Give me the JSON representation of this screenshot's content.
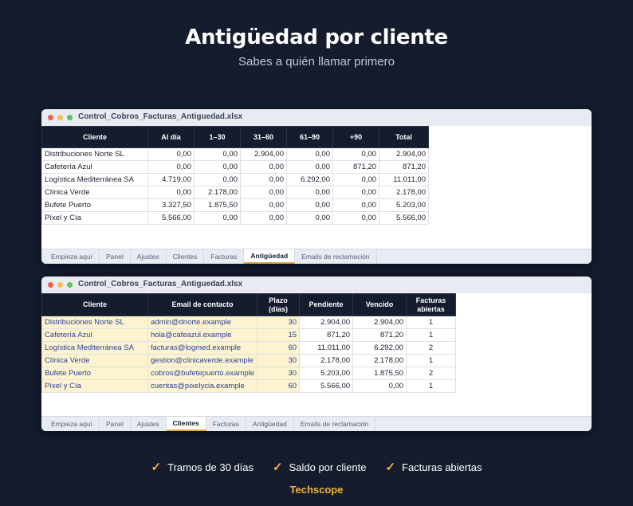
{
  "hero": {
    "title": "Antigüedad por cliente",
    "subtitle": "Sabes a quién llamar primero"
  },
  "colors": {
    "background": "#141c2e",
    "accent": "#f0b43c",
    "header_bg": "#141c2e",
    "highlight": "#fdf4cf",
    "link_text": "#2a3f9a"
  },
  "window1": {
    "filename": "Control_Cobros_Facturas_Antiguedad.xlsx",
    "headers": [
      "Cliente",
      "Al día",
      "1–30",
      "31–60",
      "61–90",
      "+90",
      "Total"
    ],
    "rows": [
      [
        "Distribuciones Norte SL",
        "0,00",
        "0,00",
        "2.904,00",
        "0,00",
        "0,00",
        "2.904,00"
      ],
      [
        "Cafetería Azul",
        "0,00",
        "0,00",
        "0,00",
        "0,00",
        "871,20",
        "871,20"
      ],
      [
        "Logística Mediterránea SA",
        "4.719,00",
        "0,00",
        "0,00",
        "6.292,00",
        "0,00",
        "11.011,00"
      ],
      [
        "Clínica Verde",
        "0,00",
        "2.178,00",
        "0,00",
        "0,00",
        "0,00",
        "2.178,00"
      ],
      [
        "Bufete Puerto",
        "3.327,50",
        "1.875,50",
        "0,00",
        "0,00",
        "0,00",
        "5.203,00"
      ],
      [
        "Píxel y Cía",
        "5.566,00",
        "0,00",
        "0,00",
        "0,00",
        "0,00",
        "5.566,00"
      ]
    ],
    "tabs": [
      "Empieza aquí",
      "Panel",
      "Ajustes",
      "Clientes",
      "Facturas",
      "Antigüedad",
      "Emails de reclamación"
    ],
    "active_tab": "Antigüedad"
  },
  "window2": {
    "filename": "Control_Cobros_Facturas_Antiguedad.xlsx",
    "headers": [
      "Cliente",
      "Email de contacto",
      "Plazo\n(días)",
      "Pendiente",
      "Vencido",
      "Facturas\nabiertas"
    ],
    "rows": [
      [
        "Distribuciones Norte SL",
        "admin@dnorte.example",
        "30",
        "2.904,00",
        "2.904,00",
        "1"
      ],
      [
        "Cafetería Azul",
        "hola@cafeazul.example",
        "15",
        "871,20",
        "871,20",
        "1"
      ],
      [
        "Logística Mediterránea SA",
        "facturas@logmed.example",
        "60",
        "11.011,00",
        "6.292,00",
        "2"
      ],
      [
        "Clínica Verde",
        "gestion@clinicaverde.example",
        "30",
        "2.178,00",
        "2.178,00",
        "1"
      ],
      [
        "Bufete Puerto",
        "cobros@bufetepuerto.example",
        "30",
        "5.203,00",
        "1.875,50",
        "2"
      ],
      [
        "Píxel y Cía",
        "cuentas@pixelycia.example",
        "60",
        "5.566,00",
        "0,00",
        "1"
      ]
    ],
    "tabs": [
      "Empieza aquí",
      "Panel",
      "Ajustes",
      "Clientes",
      "Facturas",
      "Antigüedad",
      "Emails de reclamación"
    ],
    "active_tab": "Clientes"
  },
  "features": [
    {
      "icon": "check-icon",
      "mark": "✓",
      "label": "Tramos de 30 días"
    },
    {
      "icon": "check-icon",
      "mark": "✓",
      "label": "Saldo por cliente"
    },
    {
      "icon": "check-icon",
      "mark": "✓",
      "label": "Facturas abiertas"
    }
  ],
  "brand": "Techscope"
}
